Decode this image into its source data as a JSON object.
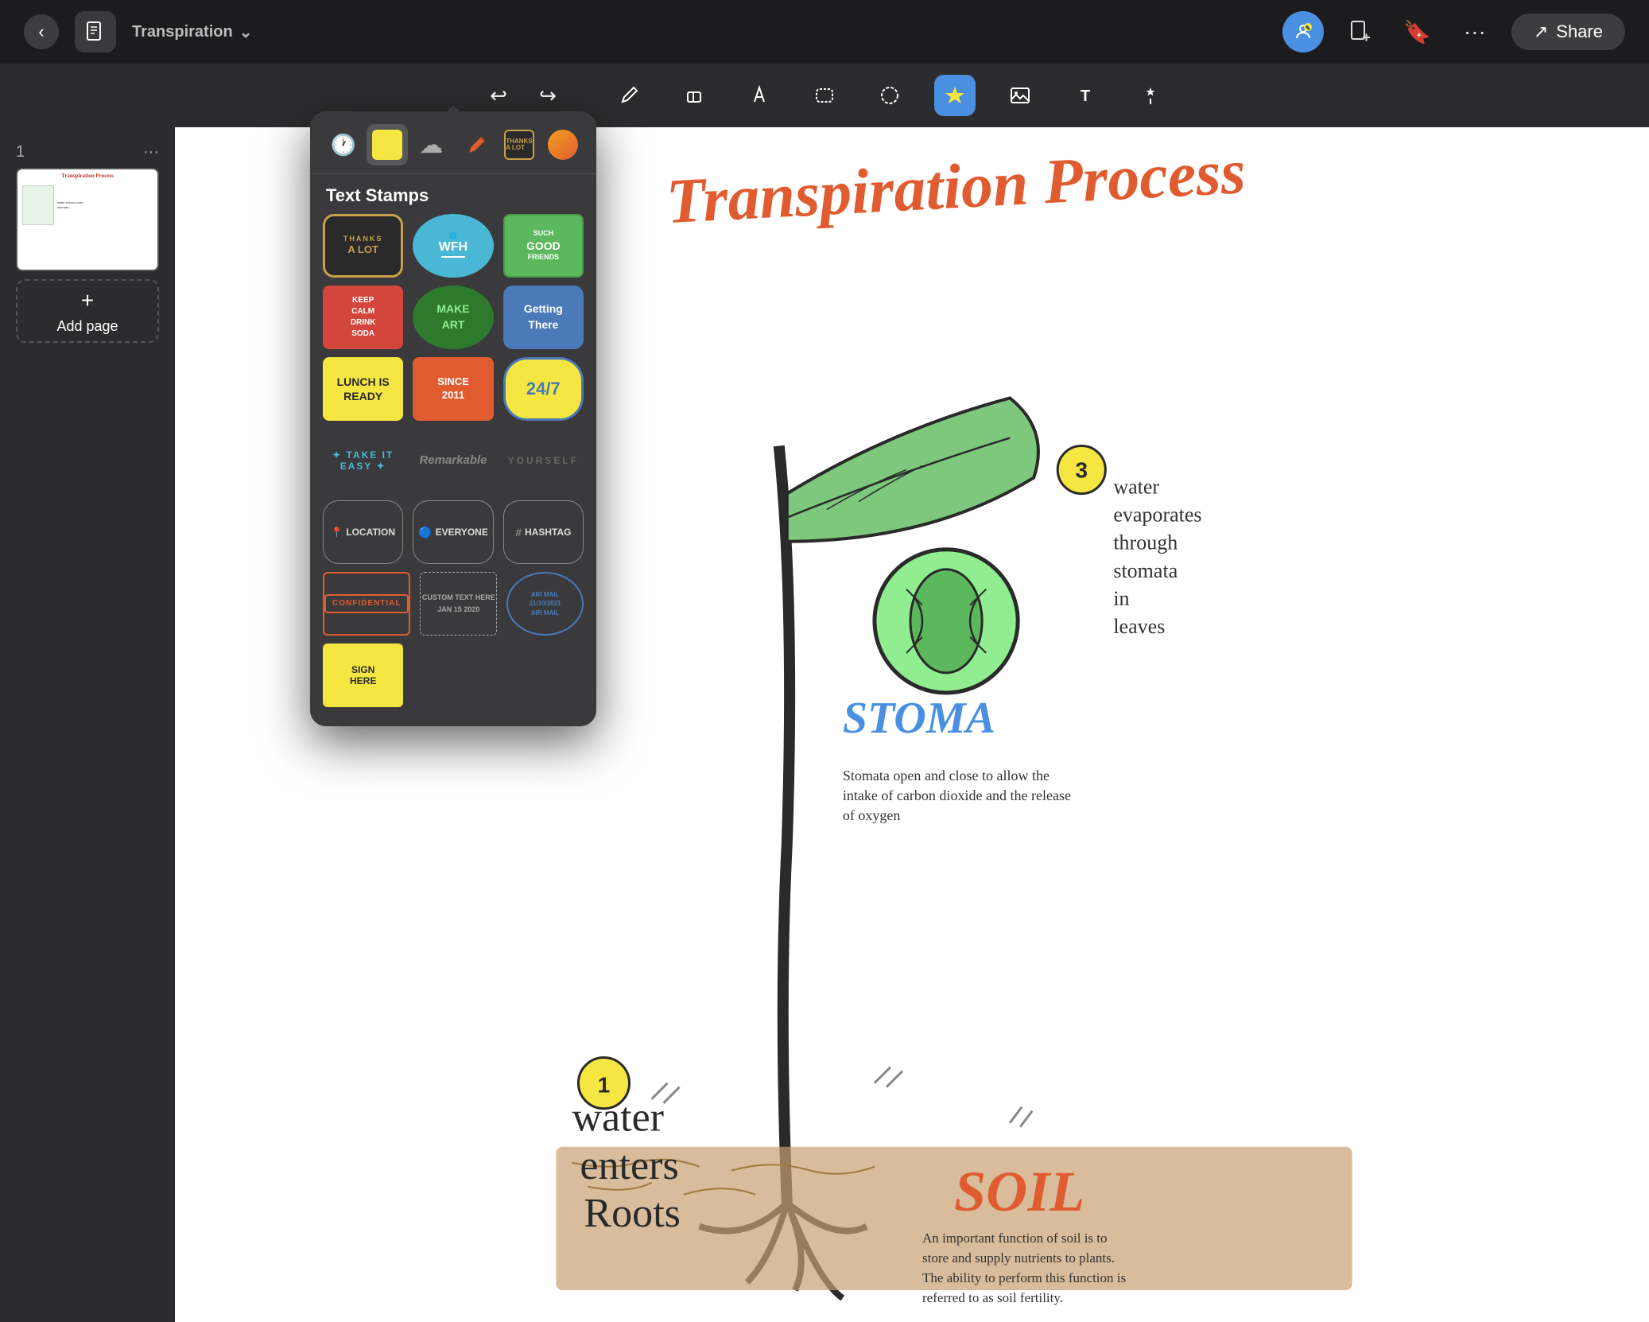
{
  "app": {
    "title": "Transpiration",
    "back_label": "‹",
    "doc_icon": "📋",
    "share_label": "Share",
    "share_icon": "↗"
  },
  "topbar": {
    "add_icon": "+",
    "bookmark_icon": "🔖",
    "more_icon": "···"
  },
  "toolbar": {
    "undo": "↩",
    "redo": "↪",
    "pencil": "✏",
    "eraser": "⬜",
    "pen": "🖊",
    "lasso": "⬡",
    "select": "⭕",
    "sticker_active": "⭐",
    "image": "🖼",
    "text": "T",
    "magic": "✨"
  },
  "sidebar": {
    "slide_num": "1",
    "more_icon": "···",
    "add_page_label": "Add page",
    "add_plus": "+"
  },
  "sticker_panel": {
    "tabs": [
      {
        "id": "recent",
        "icon": "🕐"
      },
      {
        "id": "yellow",
        "color": "#f5e642"
      },
      {
        "id": "cloud",
        "icon": "☁"
      },
      {
        "id": "pen",
        "icon": "🖊"
      },
      {
        "id": "thanks",
        "icon": "THX"
      },
      {
        "id": "orange",
        "icon": "🟠"
      }
    ],
    "category": "Text Stamps",
    "stamps": [
      {
        "id": "thanks-a-lot",
        "label": "THANKS\nA LOT",
        "style": "thanks"
      },
      {
        "id": "wfh",
        "label": "WFH",
        "style": "wfh"
      },
      {
        "id": "such-good-friends",
        "label": "SUCH\nGOOD\nFRIENDS",
        "style": "friends"
      },
      {
        "id": "keep-calm",
        "label": "KEEP\nCALM\nDRINK\nSODA",
        "style": "keep"
      },
      {
        "id": "make-art",
        "label": "MAKE\nART",
        "style": "make"
      },
      {
        "id": "getting-there",
        "label": "Getting\nThere",
        "style": "getting"
      },
      {
        "id": "lunch-is-ready",
        "label": "LUNCH IS\nREADY",
        "style": "lunch"
      },
      {
        "id": "since-2011",
        "label": "SINCE\n2011",
        "style": "since"
      },
      {
        "id": "247",
        "label": "24/7",
        "style": "247"
      },
      {
        "id": "take-it-easy",
        "label": "TAKE IT EASY",
        "style": "takeeasy"
      },
      {
        "id": "remarkable",
        "label": "Remarkable",
        "style": "remarkable"
      },
      {
        "id": "yourself",
        "label": "YOURSELF",
        "style": "yourself"
      },
      {
        "id": "location",
        "label": "LOCATION",
        "style": "location"
      },
      {
        "id": "everyone",
        "label": "EVERYONE",
        "style": "everyone"
      },
      {
        "id": "hashtag",
        "label": "#HASHTAG",
        "style": "hashtag"
      },
      {
        "id": "confidential",
        "label": "CONFIDENTIAL",
        "style": "confidential"
      },
      {
        "id": "custom-text",
        "label": "CUSTOM TEXT HERE\nJAN 15 2020",
        "style": "customtext"
      },
      {
        "id": "air-mail",
        "label": "AIR MAIL\n21/10/2021\nAIR MAIL",
        "style": "airmail"
      },
      {
        "id": "sign-here",
        "label": "SIGN\nHERE",
        "style": "signhere"
      }
    ]
  },
  "canvas": {
    "title": "Transpiration Process",
    "annotations": [
      "water evaporates through stomata in leaves",
      "STOMA",
      "Stomata open and close to allow the intake of carbon dioxide and the release of oxygen",
      "Water enters Roots",
      "SOIL",
      "An important function of soil is to store and supply nutrients to plants. The ability to perform this function is referred to as soil fertility."
    ]
  }
}
